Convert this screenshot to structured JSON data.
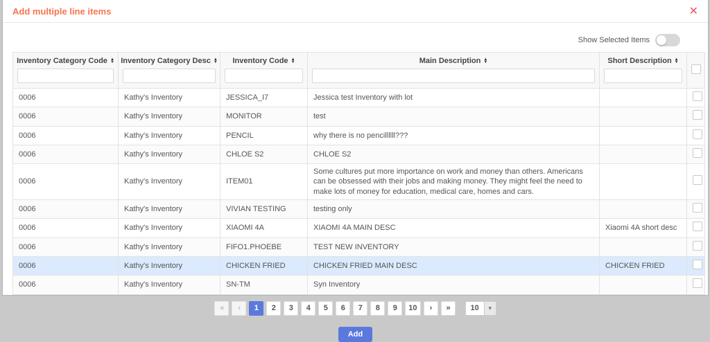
{
  "colors": {
    "title_orange": "#f4764e",
    "close_red": "#e25563",
    "accent_blue": "#5b79dd",
    "highlight_blue": "#dbeafd"
  },
  "modal": {
    "title": "Add multiple line items",
    "close_label": "✕"
  },
  "toolbar": {
    "show_selected_label": "Show Selected Items"
  },
  "table": {
    "columns": [
      {
        "label": "Inventory Category Code"
      },
      {
        "label": "Inventory Category Desc"
      },
      {
        "label": "Inventory Code"
      },
      {
        "label": "Main Description"
      },
      {
        "label": "Short Description"
      }
    ],
    "filters": {
      "category_code": "",
      "category_desc": "",
      "code": "",
      "main_desc": "",
      "short_desc": ""
    },
    "rows": [
      {
        "category_code": "0006",
        "category_desc": "Kathy's Inventory",
        "code": "JESSICA_I7",
        "main_desc": "Jessica test Inventory with lot",
        "short_desc": "",
        "highlighted": false
      },
      {
        "category_code": "0006",
        "category_desc": "Kathy's Inventory",
        "code": "MONITOR",
        "main_desc": "test",
        "short_desc": "",
        "highlighted": false
      },
      {
        "category_code": "0006",
        "category_desc": "Kathy's Inventory",
        "code": "PENCIL",
        "main_desc": "why there is no pencillllll???",
        "short_desc": "",
        "highlighted": false
      },
      {
        "category_code": "0006",
        "category_desc": "Kathy's Inventory",
        "code": "CHLOE S2",
        "main_desc": "CHLOE S2",
        "short_desc": "",
        "highlighted": false
      },
      {
        "category_code": "0006",
        "category_desc": "Kathy's Inventory",
        "code": "ITEM01",
        "main_desc": "Some cultures put more importance on work and money than others. Americans can be obsessed with their jobs and making money. They might feel the need to make lots of money for education, medical care, homes and cars.",
        "short_desc": "",
        "highlighted": false
      },
      {
        "category_code": "0006",
        "category_desc": "Kathy's Inventory",
        "code": "VIVIAN TESTING",
        "main_desc": "testing only",
        "short_desc": "",
        "highlighted": false
      },
      {
        "category_code": "0006",
        "category_desc": "Kathy's Inventory",
        "code": "XIAOMI 4A",
        "main_desc": "XIAOMI 4A MAIN DESC",
        "short_desc": "Xiaomi 4A short desc",
        "highlighted": false
      },
      {
        "category_code": "0006",
        "category_desc": "Kathy's Inventory",
        "code": "FIFO1.PHOEBE",
        "main_desc": "TEST NEW INVENTORY",
        "short_desc": "",
        "highlighted": false
      },
      {
        "category_code": "0006",
        "category_desc": "Kathy's Inventory",
        "code": "CHICKEN FRIED",
        "main_desc": "CHICKEN FRIED MAIN DESC",
        "short_desc": "CHICKEN FRIED",
        "highlighted": true
      },
      {
        "category_code": "0006",
        "category_desc": "Kathy's Inventory",
        "code": "SN-TM",
        "main_desc": "Syn Inventory",
        "short_desc": "",
        "highlighted": false
      }
    ]
  },
  "pagination": {
    "first_label": "«",
    "prev_label": "‹",
    "pages": [
      "1",
      "2",
      "3",
      "4",
      "5",
      "6",
      "7",
      "8",
      "9",
      "10"
    ],
    "active_page": "1",
    "next_label": "›",
    "last_label": "»",
    "page_size": "10"
  },
  "footer": {
    "add_label": "Add"
  }
}
